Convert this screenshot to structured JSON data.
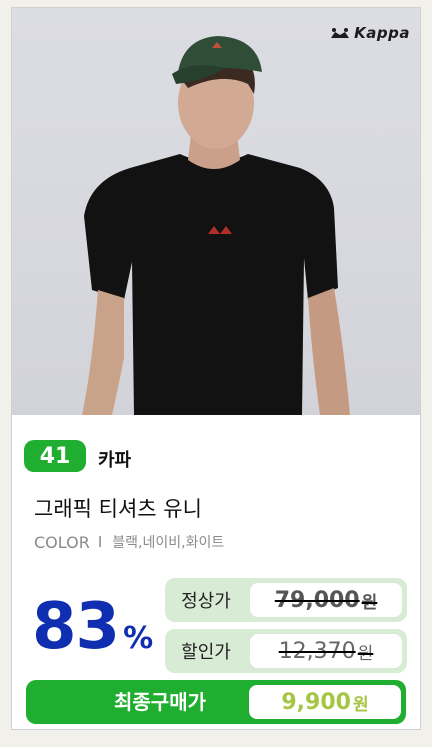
{
  "product": {
    "brand_logo_text": "Kappa",
    "rank": "41",
    "brand": "카파",
    "name": "그래픽 티셔츠 유니",
    "color_label": "COLOR",
    "color_separator": "I",
    "colors": "블랙,네이비,화이트",
    "discount_value": "83",
    "discount_unit": "%"
  },
  "pricing": {
    "regular_label": "정상가",
    "regular_price": "79,000",
    "sale_label": "할인가",
    "sale_price": "12,370",
    "final_label": "최종구매가",
    "final_price": "9,900",
    "currency": "원"
  },
  "colors": {
    "accent_green": "#1fae2f",
    "discount_blue": "#0f2fb0",
    "final_price_green": "#a7c545",
    "price_box_bg": "#d8ebd4"
  }
}
